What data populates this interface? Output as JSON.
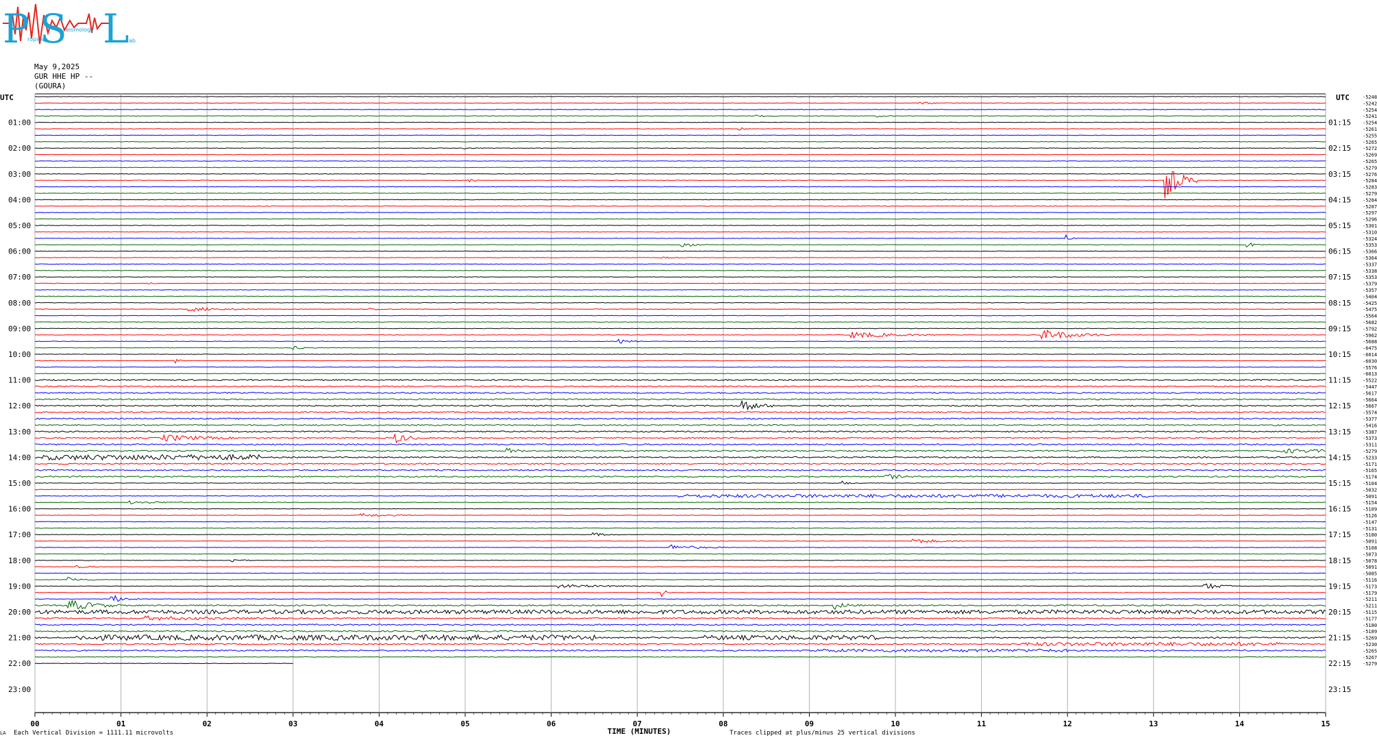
{
  "logo": {
    "letters": [
      "P",
      "S",
      "L"
    ],
    "small_text": [
      "ropical",
      "eismology",
      "ab"
    ],
    "color": "#1ba3d6"
  },
  "header": {
    "date": "May 9,2025",
    "station": "GUR HHE HP --",
    "site": "(GOURA)"
  },
  "footer": {
    "scale_note": "Each Vertical Division = 1111.11 microvolts",
    "clip_note": "Traces clipped at plus/minus 25 vertical divisions",
    "corner_mark": "LA"
  },
  "chart_data": {
    "type": "line",
    "title": "",
    "xlabel": "TIME (MINUTES)",
    "x_ticks": [
      "00",
      "01",
      "02",
      "03",
      "04",
      "05",
      "06",
      "07",
      "08",
      "09",
      "10",
      "11",
      "12",
      "13",
      "14",
      "15"
    ],
    "xlim": [
      0,
      15
    ],
    "left_axis_label": "UTC",
    "right_axis_label": "UTC",
    "left_hour_labels": [
      "01:00",
      "02:00",
      "03:00",
      "04:00",
      "05:00",
      "06:00",
      "07:00",
      "08:00",
      "09:00",
      "10:00",
      "11:00",
      "12:00",
      "13:00",
      "14:00",
      "15:00",
      "16:00",
      "17:00",
      "18:00",
      "19:00",
      "20:00",
      "21:00",
      "22:00",
      "23:00"
    ],
    "right_hour_labels": [
      "01:15",
      "02:15",
      "03:15",
      "04:15",
      "05:15",
      "06:15",
      "07:15",
      "08:15",
      "09:15",
      "10:15",
      "11:15",
      "12:15",
      "13:15",
      "14:15",
      "15:15",
      "16:15",
      "17:15",
      "18:15",
      "19:15",
      "20:15",
      "21:15",
      "22:15",
      "23:15"
    ],
    "trace_colors": [
      "#000000",
      "#ff0000",
      "#0000ff",
      "#006400"
    ],
    "trace_count": 89,
    "last_trace_end_minute": 3.0,
    "trace_offsets": [
      "-5248",
      "-5242",
      "-5254",
      "-5241",
      "-5254",
      "-5261",
      "-5255",
      "-5265",
      "-5272",
      "-5269",
      "-5265",
      "-5279",
      "-5276",
      "-5284",
      "-5283",
      "-5279",
      "-5284",
      "-5287",
      "-5297",
      "-5296",
      "-5301",
      "-5310",
      "-5324",
      "-5353",
      "-5366",
      "-5364",
      "-5337",
      "-5338",
      "-5353",
      "-5379",
      "-5357",
      "-5404",
      "-5425",
      "-5475",
      "-5564",
      "-5682",
      "-5792",
      "-5962",
      "-5688",
      "-6475",
      "-6014",
      "-6030",
      "-5576",
      "-6013",
      "-5522",
      "-5447",
      "-5617",
      "-5664",
      "-5667",
      "-5574",
      "-5377",
      "-5416",
      "-5387",
      "-5373",
      "-5311",
      "-5279",
      "-5233",
      "-5171",
      "-5165",
      "-5174",
      "-5104",
      "-5032",
      "-5091",
      "-5154",
      "-5109",
      "-5126",
      "-5147",
      "-5131",
      "-5180",
      "-5091",
      "-5108",
      "-5073",
      "-5078",
      "-5091",
      "-5085",
      "-5116",
      "-5173",
      "-5179",
      "-5211",
      "-5211",
      "-5115",
      "-5177",
      "-5180",
      "-5189",
      "-5269",
      "-5230",
      "-5265",
      "-5267",
      "-5279"
    ],
    "events": [
      {
        "trace": 1,
        "minute": 10.3,
        "amp": 0.5,
        "dur": 0.3
      },
      {
        "trace": 3,
        "minute": 8.4,
        "amp": 0.5,
        "dur": 0.3
      },
      {
        "trace": 3,
        "minute": 9.8,
        "amp": 0.4,
        "dur": 0.2
      },
      {
        "trace": 5,
        "minute": 8.2,
        "amp": 0.6,
        "dur": 0.1
      },
      {
        "trace": 8,
        "minute": 5.0,
        "amp": 0.3,
        "dur": 0.3
      },
      {
        "trace": 13,
        "minute": 13.15,
        "amp": 8.0,
        "dur": 0.35,
        "clip": true
      },
      {
        "trace": 13,
        "minute": 5.05,
        "amp": 1.0,
        "dur": 0.15
      },
      {
        "trace": 22,
        "minute": 12.0,
        "amp": 1.2,
        "dur": 0.1
      },
      {
        "trace": 23,
        "minute": 14.1,
        "amp": 1.2,
        "dur": 0.2
      },
      {
        "trace": 23,
        "minute": 7.5,
        "amp": 1.5,
        "dur": 0.3
      },
      {
        "trace": 25,
        "minute": 7.3,
        "amp": 0.4,
        "dur": 0.2
      },
      {
        "trace": 29,
        "minute": 1.3,
        "amp": 0.8,
        "dur": 0.1
      },
      {
        "trace": 33,
        "minute": 1.8,
        "amp": 1.0,
        "dur": 0.8
      },
      {
        "trace": 33,
        "minute": 3.9,
        "amp": 0.5,
        "dur": 0.4
      },
      {
        "trace": 37,
        "minute": 9.5,
        "amp": 1.5,
        "dur": 1.0
      },
      {
        "trace": 37,
        "minute": 11.7,
        "amp": 2.5,
        "dur": 0.8
      },
      {
        "trace": 38,
        "minute": 6.8,
        "amp": 0.8,
        "dur": 0.3
      },
      {
        "trace": 39,
        "minute": 3.0,
        "amp": 0.8,
        "dur": 0.3
      },
      {
        "trace": 41,
        "minute": 1.65,
        "amp": 0.8,
        "dur": 0.1
      },
      {
        "trace": 48,
        "minute": 8.2,
        "amp": 2.5,
        "dur": 0.4
      },
      {
        "trace": 53,
        "minute": 1.5,
        "amp": 1.5,
        "dur": 0.8
      },
      {
        "trace": 53,
        "minute": 4.2,
        "amp": 2.0,
        "dur": 0.3
      },
      {
        "trace": 56,
        "minute": 0.1,
        "amp": 1.2,
        "dur": 2.5
      },
      {
        "trace": 55,
        "minute": 5.5,
        "amp": 1.2,
        "dur": 0.2
      },
      {
        "trace": 55,
        "minute": 14.5,
        "amp": 1.0,
        "dur": 0.9
      },
      {
        "trace": 60,
        "minute": 9.4,
        "amp": 0.7,
        "dur": 0.2
      },
      {
        "trace": 59,
        "minute": 9.9,
        "amp": 1.2,
        "dur": 0.3
      },
      {
        "trace": 62,
        "minute": 7.5,
        "amp": 0.8,
        "dur": 5.5
      },
      {
        "trace": 63,
        "minute": 1.1,
        "amp": 0.7,
        "dur": 0.8
      },
      {
        "trace": 65,
        "minute": 3.8,
        "amp": 0.8,
        "dur": 0.6
      },
      {
        "trace": 68,
        "minute": 6.5,
        "amp": 0.8,
        "dur": 0.3
      },
      {
        "trace": 69,
        "minute": 10.2,
        "amp": 1.2,
        "dur": 0.6
      },
      {
        "trace": 70,
        "minute": 7.4,
        "amp": 1.2,
        "dur": 0.6
      },
      {
        "trace": 72,
        "minute": 2.3,
        "amp": 0.8,
        "dur": 0.2
      },
      {
        "trace": 73,
        "minute": 0.5,
        "amp": 0.5,
        "dur": 0.3
      },
      {
        "trace": 75,
        "minute": 0.4,
        "amp": 1.0,
        "dur": 0.3
      },
      {
        "trace": 76,
        "minute": 6.1,
        "amp": 0.8,
        "dur": 1.0
      },
      {
        "trace": 76,
        "minute": 13.6,
        "amp": 1.5,
        "dur": 0.4
      },
      {
        "trace": 77,
        "minute": 7.3,
        "amp": 1.5,
        "dur": 0.1
      },
      {
        "trace": 78,
        "minute": 0.9,
        "amp": 1.8,
        "dur": 0.3
      },
      {
        "trace": 79,
        "minute": 0.4,
        "amp": 2.5,
        "dur": 0.6
      },
      {
        "trace": 79,
        "minute": 9.3,
        "amp": 1.5,
        "dur": 0.3
      },
      {
        "trace": 80,
        "minute": 0.0,
        "amp": 0.8,
        "dur": 15.0
      },
      {
        "trace": 81,
        "minute": 1.3,
        "amp": 0.8,
        "dur": 1.5
      },
      {
        "trace": 84,
        "minute": 0.5,
        "amp": 1.2,
        "dur": 6.0
      },
      {
        "trace": 84,
        "minute": 7.8,
        "amp": 1.0,
        "dur": 2.0
      },
      {
        "trace": 85,
        "minute": 11.5,
        "amp": 0.7,
        "dur": 3.0
      },
      {
        "trace": 86,
        "minute": 9.0,
        "amp": 0.5,
        "dur": 3.0
      }
    ]
  }
}
